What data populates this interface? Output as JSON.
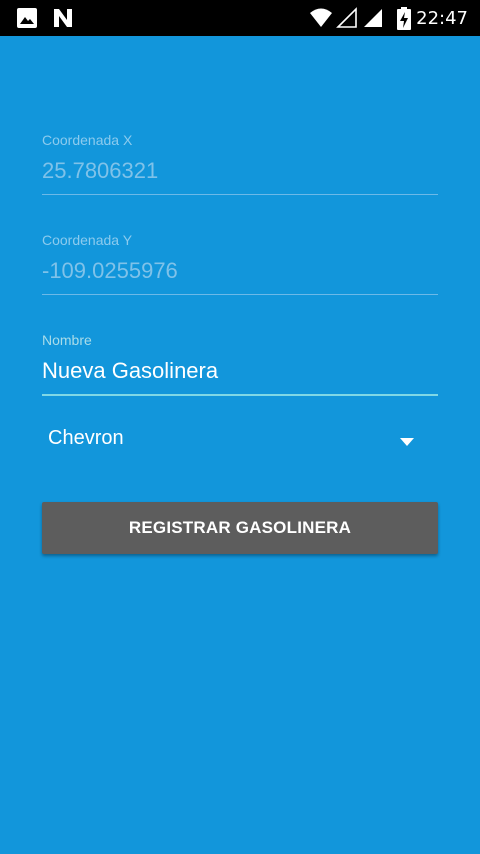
{
  "status_bar": {
    "time": "22:47",
    "icons": [
      "image-icon",
      "n-notification-icon",
      "wifi-icon",
      "signal-empty-icon",
      "signal-icon",
      "battery-charging-icon"
    ]
  },
  "form": {
    "coord_x": {
      "label": "Coordenada X",
      "value": "25.7806321"
    },
    "coord_y": {
      "label": "Coordenada Y",
      "value": "-109.0255976"
    },
    "nombre": {
      "label": "Nombre",
      "value": "Nueva Gasolinera"
    },
    "brand_select": {
      "selected": "Chevron"
    },
    "submit_label": "REGISTRAR GASOLINERA"
  },
  "colors": {
    "background": "#1296DB",
    "status_bar": "#000000",
    "button": "#5D5D5D",
    "active_underline": "#7FD8E6"
  }
}
